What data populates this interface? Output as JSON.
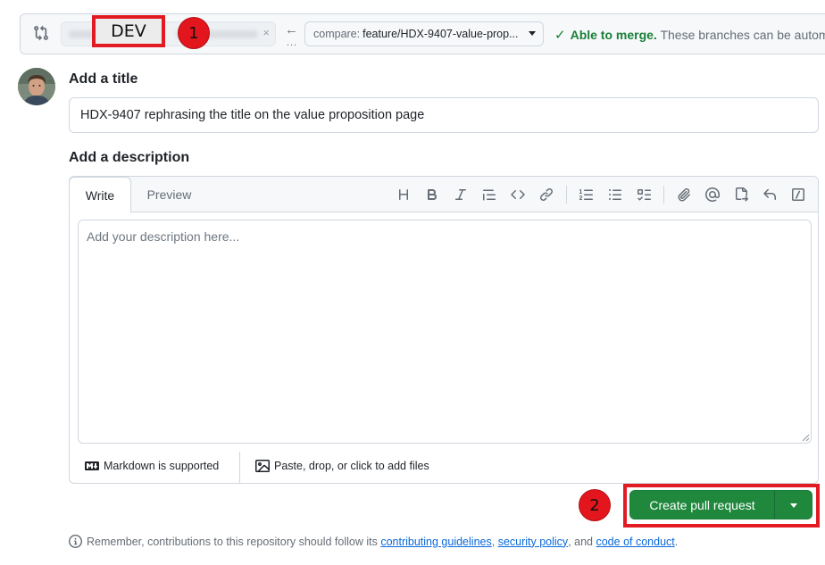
{
  "compare": {
    "base_value_blurred": "base: main",
    "arrow": "←",
    "arrow_dots": "...",
    "head_prefix": "compare:",
    "head_branch": "feature/HDX-9407-value-prop...",
    "merge_ok": "Able to merge.",
    "merge_rest": "These branches can be autom",
    "check_icon": "✓"
  },
  "annotations": {
    "dev_label": "DEV",
    "badge_1": "1",
    "badge_2": "2",
    "highlight_color": "#e21b23"
  },
  "form": {
    "title_label": "Add a title",
    "title_value": "HDX-9407 rephrasing the title on the value proposition page",
    "description_label": "Add a description",
    "tabs": {
      "write": "Write",
      "preview": "Preview"
    },
    "description_placeholder": "Add your description here...",
    "markdown_note": "Markdown is supported",
    "attach_note": "Paste, drop, or click to add files"
  },
  "actions": {
    "create_label": "Create pull request",
    "accent": "#1f883d"
  },
  "footnote": {
    "prefix": "Remember, contributions to this repository should follow its",
    "link1": "contributing guidelines",
    "sep1": ",",
    "link2": "security policy",
    "sep2": ", and",
    "link3": "code of conduct",
    "end": "."
  }
}
